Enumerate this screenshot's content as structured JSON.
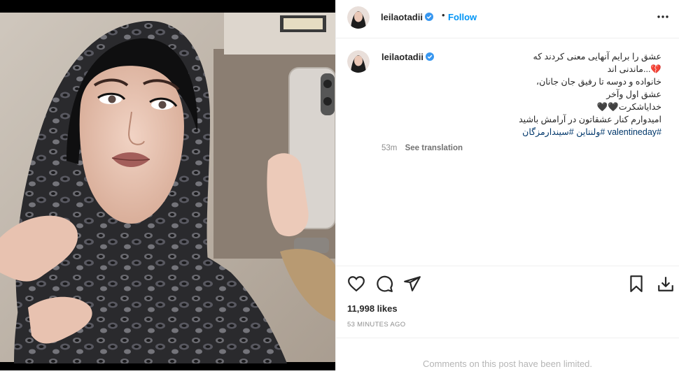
{
  "post": {
    "image_alt": "photo"
  },
  "header": {
    "username": "leilaotadii",
    "separator": "•",
    "follow_label": "Follow",
    "more_icon": "more-horizontal-icon"
  },
  "caption": {
    "username": "leilaotadii",
    "lines": [
      "عشق را برایم آنهایی معنی کردند که",
      "💔...ماندنی اند",
      "خانواده و دوسه تا رفیق جان جانان،",
      "عشق اول وآخر",
      "خدایاشکرت🖤🖤",
      "امیدوارم کنار عشقاتون در آرامش باشید"
    ],
    "tags": [
      "#valentineday",
      "#ولنتاین",
      "#سیندارمزگان"
    ],
    "age": "53m",
    "see_translation": "See translation"
  },
  "actions": {
    "like_icon": "heart-icon",
    "comment_icon": "comment-icon",
    "share_icon": "paper-plane-icon",
    "save_icon": "bookmark-icon",
    "download_icon": "download-icon"
  },
  "likes": "11,998 likes",
  "timestamp": "53 MINUTES AGO",
  "comments_notice": "Comments on this post have been limited.",
  "colors": {
    "accent": "#0095f6",
    "verified": "#3897f0",
    "hashtag": "#00376b",
    "muted": "#8e8e8e"
  }
}
